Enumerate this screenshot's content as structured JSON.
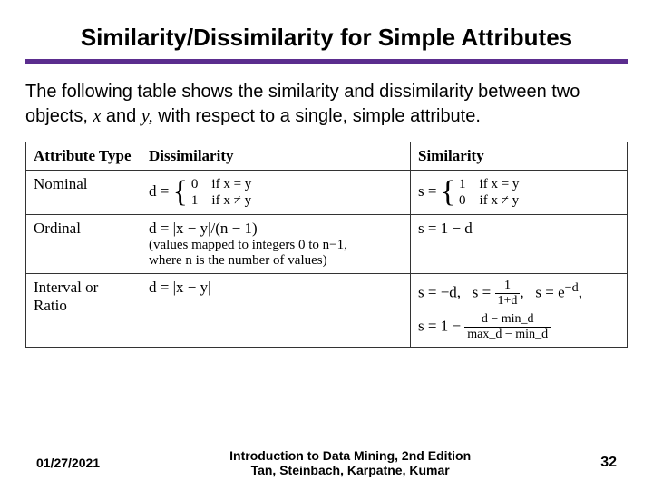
{
  "title": "Similarity/Dissimilarity for Simple Attributes",
  "body": {
    "pre": "The following table shows the similarity and dissimilarity between two objects, ",
    "x": "x",
    "mid1": " and ",
    "y": "y,",
    "post": " with respect to a single, simple attribute."
  },
  "headers": {
    "attr": "Attribute Type",
    "dis": "Dissimilarity",
    "sim": "Similarity"
  },
  "rows": {
    "nominal": {
      "label": "Nominal",
      "d_pre": "d = ",
      "d_l1": "0 if x = y",
      "d_l2": "1 if x ≠ y",
      "s_pre": "s = ",
      "s_l1": "1 if x = y",
      "s_l2": "0 if x ≠ y"
    },
    "ordinal": {
      "label": "Ordinal",
      "d_main": "d = |x − y|/(n − 1)",
      "d_note1": "(values mapped to integers 0 to n−1,",
      "d_note2": "where n is the number of values)",
      "s": "s = 1 − d"
    },
    "interval": {
      "label": "Interval or Ratio",
      "d": "d = |x − y|",
      "s1a": "s = −d,   s = ",
      "s1_num": "1",
      "s1_den": "1+d",
      "s1b": ",   s = e",
      "s1_exp": "−d",
      "s1c": ",",
      "s2a": "s = 1 − ",
      "s2_num": "d − min_d",
      "s2_den": "max_d − min_d"
    }
  },
  "footer": {
    "date": "01/27/2021",
    "book1": "Introduction to Data Mining, 2nd Edition",
    "book2": "Tan, Steinbach, Karpatne, Kumar",
    "page": "32"
  }
}
